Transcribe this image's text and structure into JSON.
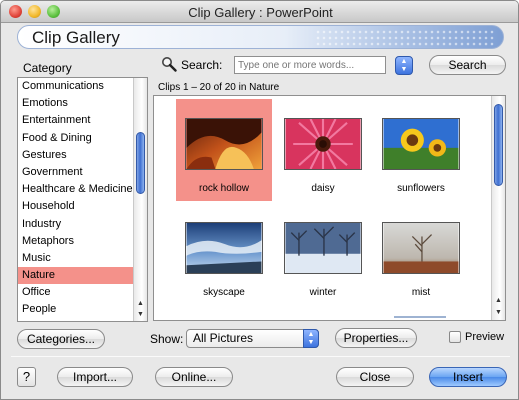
{
  "window": {
    "title": "Clip Gallery : PowerPoint"
  },
  "banner": {
    "title": "Clip Gallery"
  },
  "category": {
    "label": "Category",
    "items": [
      "Communications",
      "Emotions",
      "Entertainment",
      "Food & Dining",
      "Gestures",
      "Government",
      "Healthcare & Medicine",
      "Household",
      "Industry",
      "Metaphors",
      "Music",
      "Nature",
      "Office",
      "People"
    ],
    "selected": "Nature"
  },
  "search": {
    "label": "Search:",
    "placeholder": "Type one or more words...",
    "button": "Search"
  },
  "clips": {
    "count_text": "Clips 1 – 20 of 20 in Nature",
    "items": [
      {
        "label": "rock hollow",
        "selected": true
      },
      {
        "label": "daisy",
        "selected": false
      },
      {
        "label": "sunflowers",
        "selected": false
      },
      {
        "label": "skyscape",
        "selected": false
      },
      {
        "label": "winter",
        "selected": false
      },
      {
        "label": "mist",
        "selected": false
      }
    ]
  },
  "buttons": {
    "categories": "Categories...",
    "properties": "Properties...",
    "import": "Import...",
    "online": "Online...",
    "close": "Close",
    "insert": "Insert",
    "help": "?"
  },
  "show": {
    "label": "Show:",
    "value": "All Pictures"
  },
  "preview": {
    "label": "Preview",
    "checked": false
  },
  "colors": {
    "selection": "#f4918a",
    "accent": "#4a8ae8"
  }
}
